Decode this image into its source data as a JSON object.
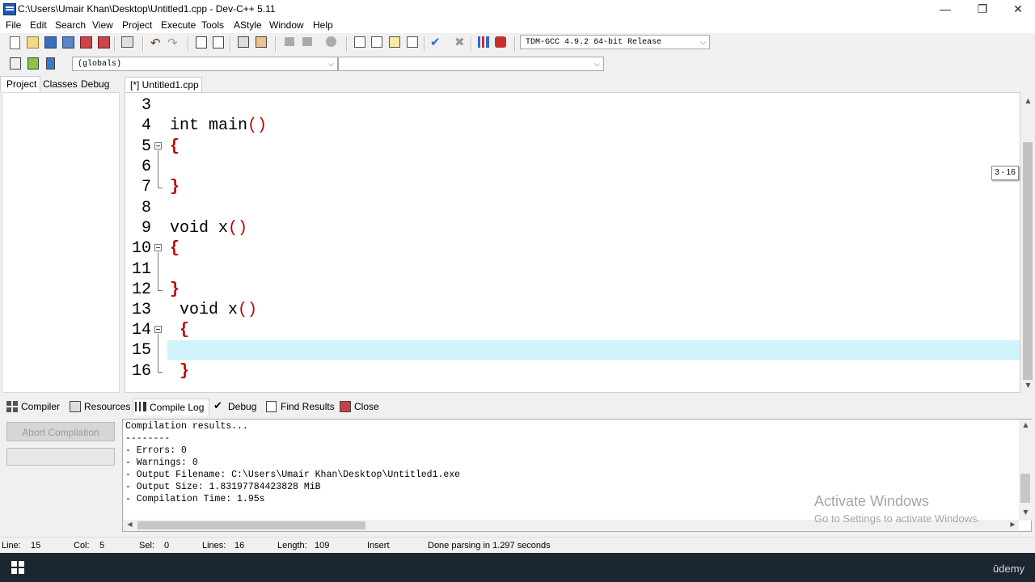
{
  "window": {
    "title": "C:\\Users\\Umair Khan\\Desktop\\Untitled1.cpp - Dev-C++ 5.11",
    "minimize": "—",
    "restore": "❐",
    "close": "✕"
  },
  "menu": [
    "File",
    "Edit",
    "Search",
    "View",
    "Project",
    "Execute",
    "Tools",
    "AStyle",
    "Window",
    "Help"
  ],
  "toolbar": {
    "compiler_select": "TDM-GCC 4.9.2 64-bit Release",
    "scope_select": "(globals)",
    "member_select": ""
  },
  "left_tabs": [
    "Project",
    "Classes",
    "Debug"
  ],
  "editor": {
    "tab_label": "[*] Untitled1.cpp",
    "lines": [
      {
        "num": "3",
        "code": ""
      },
      {
        "num": "4",
        "code": "int main()"
      },
      {
        "num": "5",
        "code": "{"
      },
      {
        "num": "6",
        "code": ""
      },
      {
        "num": "7",
        "code": "}"
      },
      {
        "num": "8",
        "code": ""
      },
      {
        "num": "9",
        "code": "void x()"
      },
      {
        "num": "10",
        "code": "{"
      },
      {
        "num": "11",
        "code": ""
      },
      {
        "num": "12",
        "code": "}"
      },
      {
        "num": "13",
        "code": " void x()"
      },
      {
        "num": "14",
        "code": " {"
      },
      {
        "num": "15",
        "code": ""
      },
      {
        "num": "16",
        "code": " }"
      }
    ],
    "scroll_hint": "3 - 16"
  },
  "bottom_tabs": [
    "Compiler",
    "Resources",
    "Compile Log",
    "Debug",
    "Find Results",
    "Close"
  ],
  "abort_button": "Abort Compilation",
  "compile_log": [
    "Compilation results...",
    "--------",
    "- Errors: 0",
    "- Warnings: 0",
    "- Output Filename: C:\\Users\\Umair Khan\\Desktop\\Untitled1.exe",
    "- Output Size: 1.83197784423828 MiB",
    "- Compilation Time: 1.95s"
  ],
  "watermark": {
    "line1": "Activate Windows",
    "line2": "Go to Settings to activate Windows."
  },
  "status": {
    "line_label": "Line:",
    "line": "15",
    "col_label": "Col:",
    "col": "5",
    "sel_label": "Sel:",
    "sel": "0",
    "lines_label": "Lines:",
    "lines": "16",
    "length_label": "Length:",
    "length": "109",
    "mode": "Insert",
    "message": "Done parsing in 1.297 seconds"
  },
  "taskbar": {
    "brand": "ūdemy"
  },
  "colors": {
    "brace": "#c00000",
    "active_line": "#cef3fb",
    "taskbar": "#1b2630"
  }
}
